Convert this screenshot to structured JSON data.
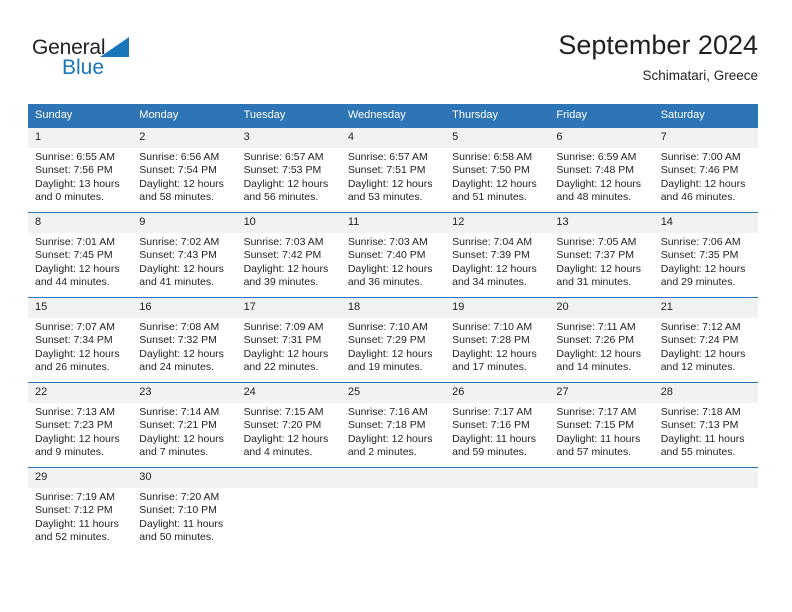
{
  "brand": {
    "name_top": "General",
    "name_bottom": "Blue",
    "accent_color": "#1b75bb"
  },
  "header": {
    "month_title": "September 2024",
    "location": "Schimatari, Greece"
  },
  "calendar": {
    "header_bg": "#2e75b6",
    "daynum_bg": "#f2f2f2",
    "weekdays": [
      "Sunday",
      "Monday",
      "Tuesday",
      "Wednesday",
      "Thursday",
      "Friday",
      "Saturday"
    ],
    "weeks": [
      [
        {
          "day": "1",
          "sunrise": "Sunrise: 6:55 AM",
          "sunset": "Sunset: 7:56 PM",
          "daylight_1": "Daylight: 13 hours",
          "daylight_2": "and 0 minutes."
        },
        {
          "day": "2",
          "sunrise": "Sunrise: 6:56 AM",
          "sunset": "Sunset: 7:54 PM",
          "daylight_1": "Daylight: 12 hours",
          "daylight_2": "and 58 minutes."
        },
        {
          "day": "3",
          "sunrise": "Sunrise: 6:57 AM",
          "sunset": "Sunset: 7:53 PM",
          "daylight_1": "Daylight: 12 hours",
          "daylight_2": "and 56 minutes."
        },
        {
          "day": "4",
          "sunrise": "Sunrise: 6:57 AM",
          "sunset": "Sunset: 7:51 PM",
          "daylight_1": "Daylight: 12 hours",
          "daylight_2": "and 53 minutes."
        },
        {
          "day": "5",
          "sunrise": "Sunrise: 6:58 AM",
          "sunset": "Sunset: 7:50 PM",
          "daylight_1": "Daylight: 12 hours",
          "daylight_2": "and 51 minutes."
        },
        {
          "day": "6",
          "sunrise": "Sunrise: 6:59 AM",
          "sunset": "Sunset: 7:48 PM",
          "daylight_1": "Daylight: 12 hours",
          "daylight_2": "and 48 minutes."
        },
        {
          "day": "7",
          "sunrise": "Sunrise: 7:00 AM",
          "sunset": "Sunset: 7:46 PM",
          "daylight_1": "Daylight: 12 hours",
          "daylight_2": "and 46 minutes."
        }
      ],
      [
        {
          "day": "8",
          "sunrise": "Sunrise: 7:01 AM",
          "sunset": "Sunset: 7:45 PM",
          "daylight_1": "Daylight: 12 hours",
          "daylight_2": "and 44 minutes."
        },
        {
          "day": "9",
          "sunrise": "Sunrise: 7:02 AM",
          "sunset": "Sunset: 7:43 PM",
          "daylight_1": "Daylight: 12 hours",
          "daylight_2": "and 41 minutes."
        },
        {
          "day": "10",
          "sunrise": "Sunrise: 7:03 AM",
          "sunset": "Sunset: 7:42 PM",
          "daylight_1": "Daylight: 12 hours",
          "daylight_2": "and 39 minutes."
        },
        {
          "day": "11",
          "sunrise": "Sunrise: 7:03 AM",
          "sunset": "Sunset: 7:40 PM",
          "daylight_1": "Daylight: 12 hours",
          "daylight_2": "and 36 minutes."
        },
        {
          "day": "12",
          "sunrise": "Sunrise: 7:04 AM",
          "sunset": "Sunset: 7:39 PM",
          "daylight_1": "Daylight: 12 hours",
          "daylight_2": "and 34 minutes."
        },
        {
          "day": "13",
          "sunrise": "Sunrise: 7:05 AM",
          "sunset": "Sunset: 7:37 PM",
          "daylight_1": "Daylight: 12 hours",
          "daylight_2": "and 31 minutes."
        },
        {
          "day": "14",
          "sunrise": "Sunrise: 7:06 AM",
          "sunset": "Sunset: 7:35 PM",
          "daylight_1": "Daylight: 12 hours",
          "daylight_2": "and 29 minutes."
        }
      ],
      [
        {
          "day": "15",
          "sunrise": "Sunrise: 7:07 AM",
          "sunset": "Sunset: 7:34 PM",
          "daylight_1": "Daylight: 12 hours",
          "daylight_2": "and 26 minutes."
        },
        {
          "day": "16",
          "sunrise": "Sunrise: 7:08 AM",
          "sunset": "Sunset: 7:32 PM",
          "daylight_1": "Daylight: 12 hours",
          "daylight_2": "and 24 minutes."
        },
        {
          "day": "17",
          "sunrise": "Sunrise: 7:09 AM",
          "sunset": "Sunset: 7:31 PM",
          "daylight_1": "Daylight: 12 hours",
          "daylight_2": "and 22 minutes."
        },
        {
          "day": "18",
          "sunrise": "Sunrise: 7:10 AM",
          "sunset": "Sunset: 7:29 PM",
          "daylight_1": "Daylight: 12 hours",
          "daylight_2": "and 19 minutes."
        },
        {
          "day": "19",
          "sunrise": "Sunrise: 7:10 AM",
          "sunset": "Sunset: 7:28 PM",
          "daylight_1": "Daylight: 12 hours",
          "daylight_2": "and 17 minutes."
        },
        {
          "day": "20",
          "sunrise": "Sunrise: 7:11 AM",
          "sunset": "Sunset: 7:26 PM",
          "daylight_1": "Daylight: 12 hours",
          "daylight_2": "and 14 minutes."
        },
        {
          "day": "21",
          "sunrise": "Sunrise: 7:12 AM",
          "sunset": "Sunset: 7:24 PM",
          "daylight_1": "Daylight: 12 hours",
          "daylight_2": "and 12 minutes."
        }
      ],
      [
        {
          "day": "22",
          "sunrise": "Sunrise: 7:13 AM",
          "sunset": "Sunset: 7:23 PM",
          "daylight_1": "Daylight: 12 hours",
          "daylight_2": "and 9 minutes."
        },
        {
          "day": "23",
          "sunrise": "Sunrise: 7:14 AM",
          "sunset": "Sunset: 7:21 PM",
          "daylight_1": "Daylight: 12 hours",
          "daylight_2": "and 7 minutes."
        },
        {
          "day": "24",
          "sunrise": "Sunrise: 7:15 AM",
          "sunset": "Sunset: 7:20 PM",
          "daylight_1": "Daylight: 12 hours",
          "daylight_2": "and 4 minutes."
        },
        {
          "day": "25",
          "sunrise": "Sunrise: 7:16 AM",
          "sunset": "Sunset: 7:18 PM",
          "daylight_1": "Daylight: 12 hours",
          "daylight_2": "and 2 minutes."
        },
        {
          "day": "26",
          "sunrise": "Sunrise: 7:17 AM",
          "sunset": "Sunset: 7:16 PM",
          "daylight_1": "Daylight: 11 hours",
          "daylight_2": "and 59 minutes."
        },
        {
          "day": "27",
          "sunrise": "Sunrise: 7:17 AM",
          "sunset": "Sunset: 7:15 PM",
          "daylight_1": "Daylight: 11 hours",
          "daylight_2": "and 57 minutes."
        },
        {
          "day": "28",
          "sunrise": "Sunrise: 7:18 AM",
          "sunset": "Sunset: 7:13 PM",
          "daylight_1": "Daylight: 11 hours",
          "daylight_2": "and 55 minutes."
        }
      ],
      [
        {
          "day": "29",
          "sunrise": "Sunrise: 7:19 AM",
          "sunset": "Sunset: 7:12 PM",
          "daylight_1": "Daylight: 11 hours",
          "daylight_2": "and 52 minutes."
        },
        {
          "day": "30",
          "sunrise": "Sunrise: 7:20 AM",
          "sunset": "Sunset: 7:10 PM",
          "daylight_1": "Daylight: 11 hours",
          "daylight_2": "and 50 minutes."
        },
        null,
        null,
        null,
        null,
        null
      ]
    ]
  }
}
